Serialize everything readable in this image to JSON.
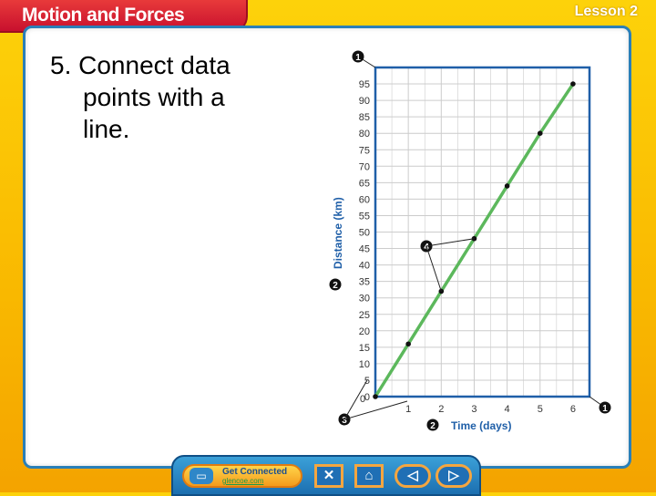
{
  "header": {
    "title": "Motion and Forces",
    "lesson": "Lesson 2"
  },
  "content": {
    "bullet_lines": [
      "5. Connect data",
      "points with a",
      "line."
    ]
  },
  "chart_data": {
    "type": "line",
    "x": [
      0,
      1,
      2,
      3,
      4,
      5,
      6
    ],
    "y": [
      0,
      16,
      32,
      48,
      64,
      80,
      95
    ],
    "xlabel": "Time (days)",
    "ylabel": "Distance (km)",
    "xlim": [
      0,
      6.5
    ],
    "ylim": [
      0,
      100
    ],
    "xticks": [
      0,
      1,
      2,
      3,
      4,
      5,
      6
    ],
    "yticks": [
      0,
      5,
      10,
      15,
      20,
      25,
      30,
      35,
      40,
      45,
      50,
      55,
      60,
      65,
      70,
      75,
      80,
      85,
      90,
      95
    ],
    "grid": true,
    "line_color": "#5cb85c",
    "axis_color": "#1f5fa8",
    "callouts": [
      "1",
      "1",
      "2",
      "2",
      "3",
      "4"
    ]
  },
  "nav": {
    "get_connected": "Get Connected",
    "site": "glencoe.com",
    "close_icon": "✕",
    "home_icon": "⌂",
    "prev_icon": "◁",
    "next_icon": "▷",
    "computer_icon": "▭"
  }
}
